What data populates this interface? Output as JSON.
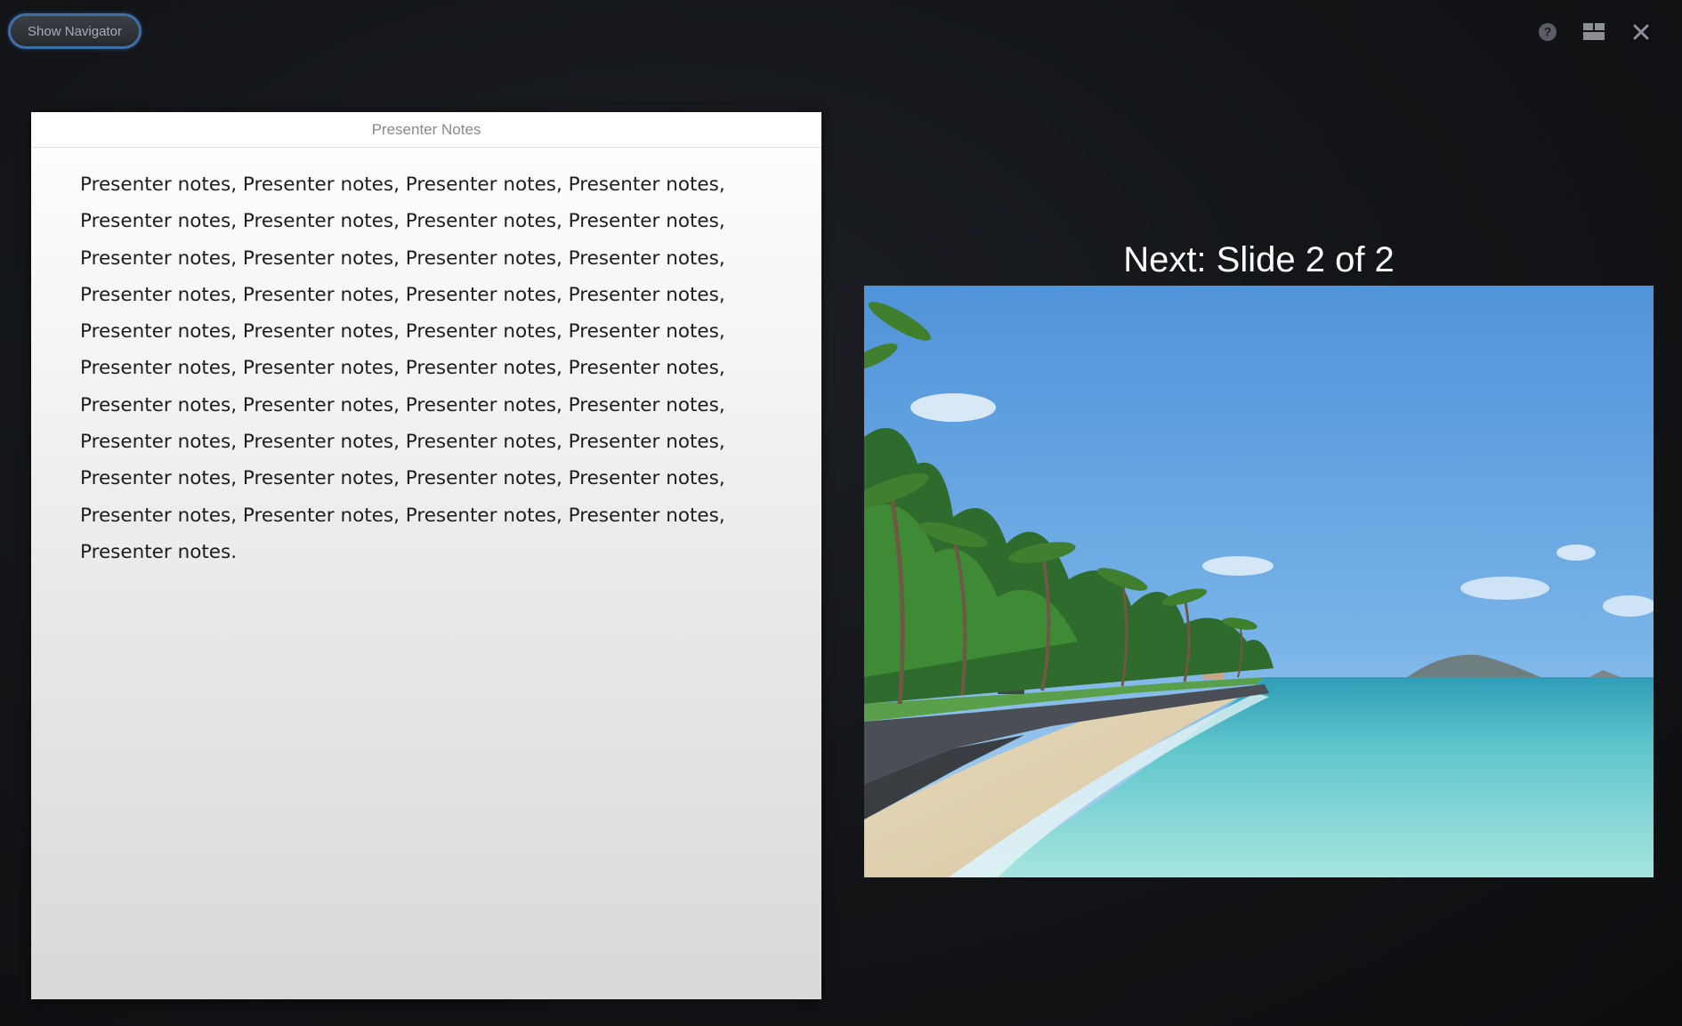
{
  "toolbar": {
    "show_navigator_label": "Show Navigator",
    "help_icon": "help-circle-icon",
    "layout_icon": "layout-grid-icon",
    "close_icon": "close-icon"
  },
  "notes": {
    "header": "Presenter Notes",
    "text": "Presenter notes, Presenter notes, Presenter notes, Presenter notes,\nPresenter notes, Presenter notes, Presenter notes, Presenter notes,\nPresenter notes, Presenter notes, Presenter notes, Presenter notes,\nPresenter notes, Presenter notes, Presenter notes, Presenter notes,\nPresenter notes, Presenter notes, Presenter notes, Presenter notes,\nPresenter notes, Presenter notes, Presenter notes, Presenter notes,\nPresenter notes, Presenter notes, Presenter notes, Presenter notes,\nPresenter notes, Presenter notes, Presenter notes, Presenter notes,\nPresenter notes, Presenter notes, Presenter notes, Presenter notes,\nPresenter notes, Presenter notes, Presenter notes, Presenter notes,\nPresenter notes."
  },
  "next_slide": {
    "title": "Next: Slide 2 of 2"
  },
  "colors": {
    "background": "#121417",
    "accent": "#3e6fa8",
    "sky": "#5e9fdc",
    "sea": "#7fd3d4"
  }
}
